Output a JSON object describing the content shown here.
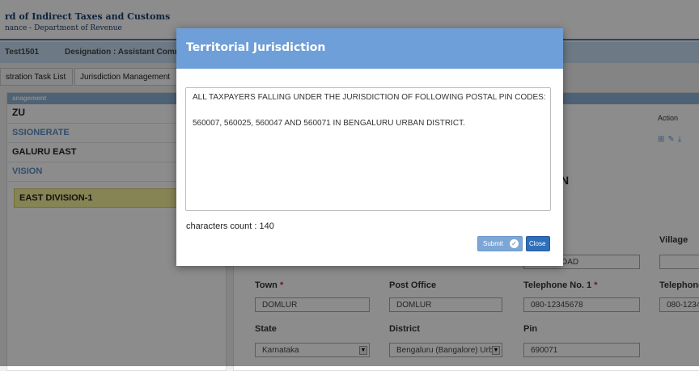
{
  "header": {
    "org_title": "rd of Indirect Taxes and Customs",
    "org_subtitle": "nance - Department of Revenue"
  },
  "userbar": {
    "user": "Test1501",
    "designation": "Designation : Assistant Comr"
  },
  "tabs": [
    {
      "label": "stration Task List"
    },
    {
      "label": "Jurisdiction Management"
    }
  ],
  "left_panel": {
    "header": "anagement",
    "zone": "ZU",
    "commissionerate_label": "SSIONERATE",
    "commissionerate": "GALURU EAST",
    "division_label": "VISION",
    "division": "EAST DIVISION-1"
  },
  "right_panel": {
    "action_header": "Action",
    "section_heading": "N",
    "fields": {
      "address_value": "PORT ROAD",
      "village_label": "Village",
      "village_value": "",
      "town_label": "Town",
      "town_value": "DOMLUR",
      "post_office_label": "Post Office",
      "post_office_value": "DOMLUR",
      "telephone1_label": "Telephone No. 1",
      "telephone1_value": "080-12345678",
      "telephone2_label": "Telephone",
      "telephone2_value": "080-1234",
      "state_label": "State",
      "state_value": "Karnataka",
      "district_label": "District",
      "district_value": "Bengaluru (Bangalore) Urbai",
      "pin_label": "Pin",
      "pin_value": "690071"
    }
  },
  "modal": {
    "title": "Territorial Jurisdiction",
    "text_line1": "ALL TAXPAYERS FALLING UNDER THE JURISDICTION OF  FOLLOWING POSTAL PIN CODES:",
    "text_line2": "560007, 560025, 560047 AND 560071 IN BENGALURU URBAN DISTRICT.",
    "char_count": "characters count : 140",
    "submit_label": "Submit",
    "close_label": "Close"
  },
  "colors": {
    "modal_header": "#6f9fd8",
    "close_button": "#2f6fb9",
    "submit_button": "#7ba6d6",
    "selected_division": "#f5ee9a",
    "required_marker": "#d9242b"
  }
}
